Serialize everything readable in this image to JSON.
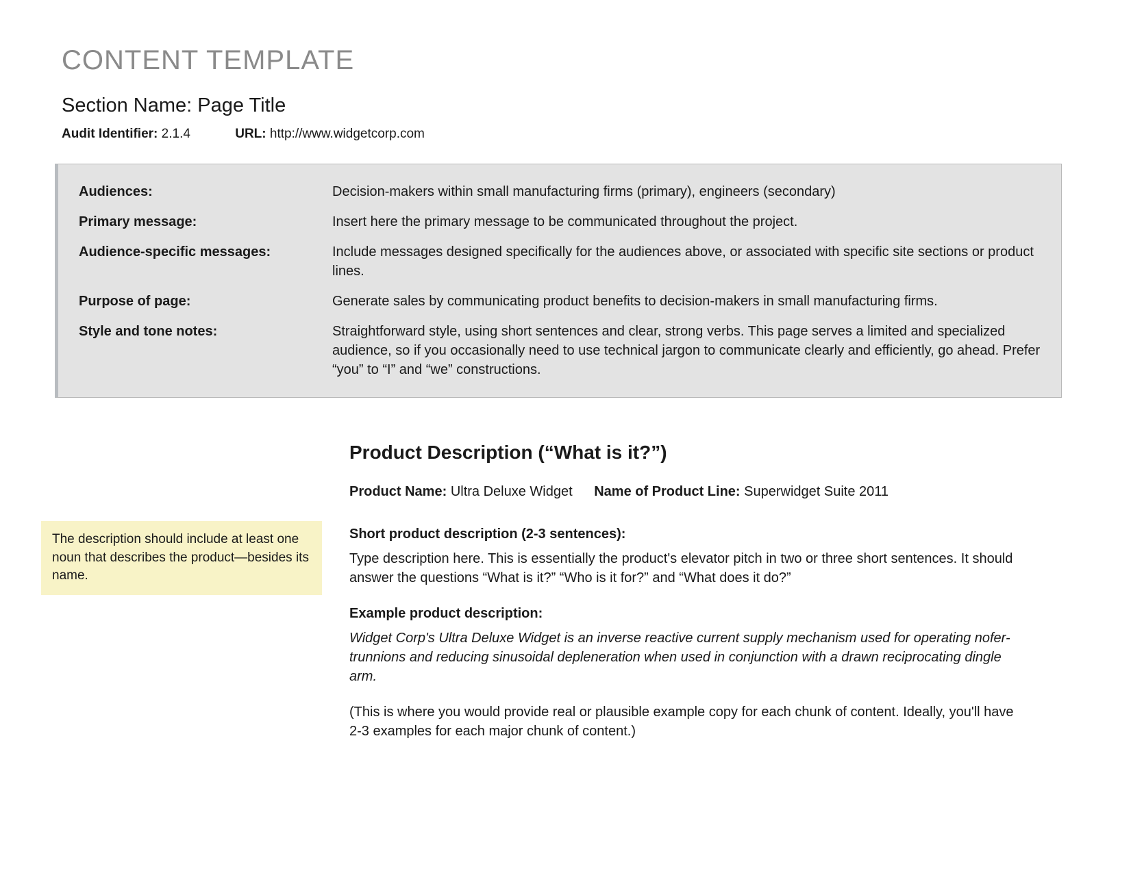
{
  "header": {
    "main_title": "CONTENT TEMPLATE",
    "section_name": "Section Name: Page Title",
    "audit_label": "Audit Identifier:",
    "audit_value": "2.1.4",
    "url_label": "URL:",
    "url_value": "http://www.widgetcorp.com"
  },
  "info_box": {
    "rows": [
      {
        "label": "Audiences:",
        "value": "Decision-makers within small manufacturing firms (primary), engineers (secondary)"
      },
      {
        "label": "Primary message:",
        "value": "Insert here the primary message to be communicated throughout the project."
      },
      {
        "label": "Audience-specific messages:",
        "value": "Include messages designed specifically for the audiences above, or associated with specific site sections or product lines."
      },
      {
        "label": "Purpose of page:",
        "value": "Generate sales by communicating product benefits to decision-makers in small manufacturing firms."
      },
      {
        "label": "Style and tone notes:",
        "value": "Straightforward style, using short sentences and clear, strong verbs. This page serves a limited and specialized audience, so if you occasionally need to use technical jargon to communicate clearly and efficiently, go ahead. Prefer “you” to “I” and “we” constructions."
      }
    ]
  },
  "side_note": "The description should include at least one noun that describes the product—besides its name.",
  "product": {
    "heading": "Product Description (“What is it?”)",
    "name_label": "Product Name:",
    "name_value": "Ultra Deluxe Widget",
    "line_label": "Name of Product Line:",
    "line_value": "Superwidget Suite 2011",
    "short_desc_label": "Short product description (2-3 sentences):",
    "short_desc_body": "Type description here. This is essentially the product's elevator pitch in two or three short sentences. It should answer the questions “What is it?” “Who is it for?” and “What does it do?”",
    "example_label": "Example product description:",
    "example_body": "Widget Corp's Ultra Deluxe Widget is an inverse reactive current supply mechanism used for operating nofer-trunnions and reducing sinusoidal depleneration when used in conjunction with a drawn reciprocating dingle arm.",
    "example_note": "(This is where you would provide real or plausible example copy for each chunk of content. Ideally, you'll have 2-3 examples for each major chunk of content.)"
  }
}
